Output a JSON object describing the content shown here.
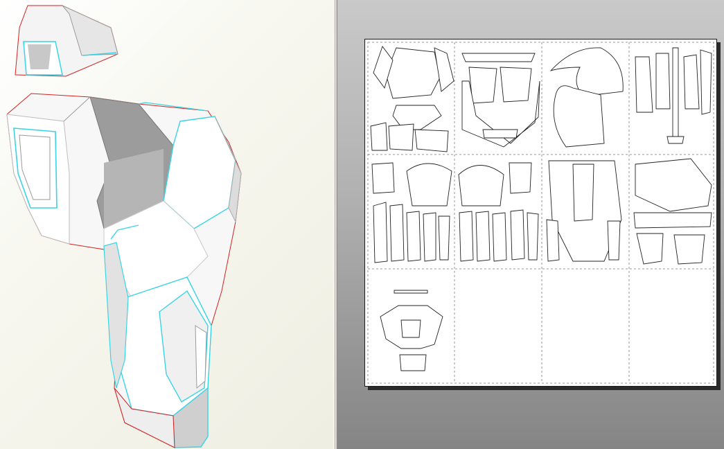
{
  "app": {
    "left_pane": "3d-model-view",
    "right_pane": "2d-unfold-layout-view"
  },
  "layout_view": {
    "sheet_grid": {
      "columns": 4,
      "rows": 3
    },
    "filled_cells": 9,
    "empty_cells": 3
  },
  "colors": {
    "model_face": "#ffffff",
    "model_shade": "#9a9a9a",
    "fold_line": "#38d4e6",
    "cut_edge": "#d42020",
    "view_background": "#f3f3ea",
    "layout_background": "#a8a8a8",
    "paper": "#ffffff",
    "guide_line": "#7a7a7a"
  }
}
